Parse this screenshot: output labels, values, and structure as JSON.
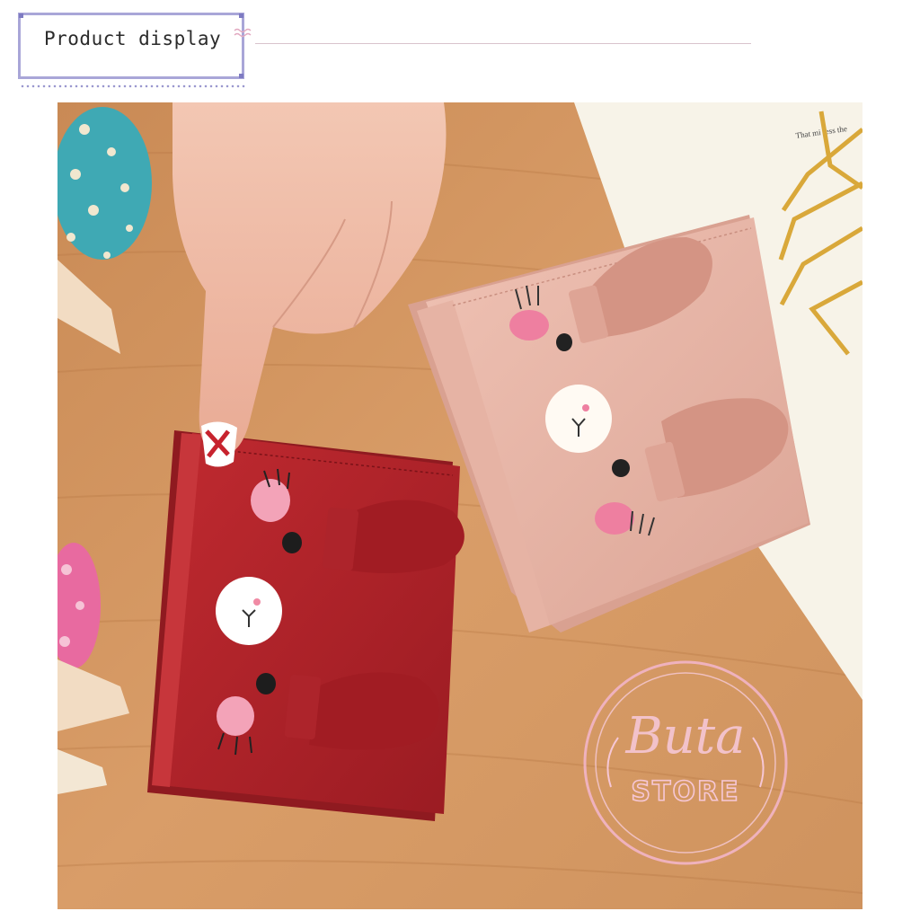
{
  "header": {
    "title": "Product display"
  },
  "photo": {
    "paper_text": "That mi ress the",
    "watermark": {
      "script": "Buta",
      "word": "STORE"
    }
  },
  "colors": {
    "frame": "#a9a6d8",
    "wood": "#d2965f",
    "red_wallet": "#b3222a",
    "pink_wallet": "#e7b4a6"
  }
}
